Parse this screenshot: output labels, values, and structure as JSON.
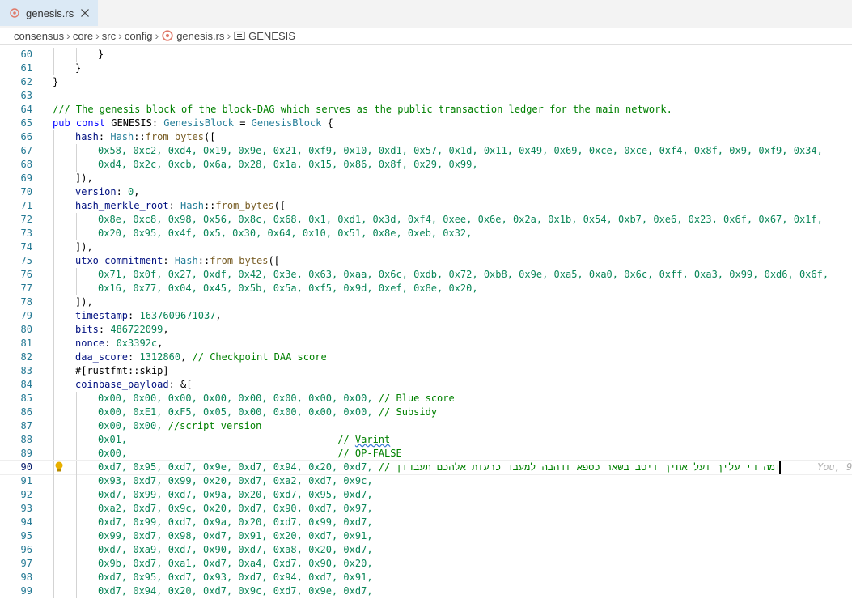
{
  "tab": {
    "filename": "genesis.rs"
  },
  "breadcrumb": [
    "consensus",
    "core",
    "src",
    "config",
    "genesis.rs",
    "GENESIS"
  ],
  "blame_text": "You, 9",
  "lines": [
    {
      "n": "60",
      "i": 2,
      "s": [
        [
          "}",
          ""
        ]
      ]
    },
    {
      "n": "61",
      "i": 1,
      "s": [
        [
          "}",
          ""
        ]
      ]
    },
    {
      "n": "62",
      "i": 0,
      "s": [
        [
          "}",
          ""
        ]
      ]
    },
    {
      "n": "63",
      "i": 0,
      "s": []
    },
    {
      "n": "64",
      "i": 0,
      "s": [
        [
          "/// The genesis block of the block-DAG which serves as the public transaction ledger for the main network.",
          "c"
        ]
      ]
    },
    {
      "n": "65",
      "i": 0,
      "s": [
        [
          "pub const ",
          "k"
        ],
        [
          "GENESIS",
          ""
        ],
        [
          ": ",
          ""
        ],
        [
          "GenesisBlock",
          "t"
        ],
        [
          " = ",
          ""
        ],
        [
          "GenesisBlock",
          "t"
        ],
        [
          " {",
          ""
        ]
      ]
    },
    {
      "n": "66",
      "i": 1,
      "s": [
        [
          "hash",
          "p"
        ],
        [
          ": ",
          ""
        ],
        [
          "Hash",
          "t"
        ],
        [
          "::",
          ""
        ],
        [
          "from_bytes",
          "f"
        ],
        [
          "([",
          ""
        ]
      ]
    },
    {
      "n": "67",
      "i": 2,
      "s": [
        [
          "0x58, 0xc2, 0xd4, 0x19, 0x9e, 0x21, 0xf9, 0x10, 0xd1, 0x57, 0x1d, 0x11, 0x49, 0x69, 0xce, 0xce, 0xf4, 0x8f, 0x9, 0xf9, 0x34,",
          "n"
        ]
      ]
    },
    {
      "n": "68",
      "i": 2,
      "s": [
        [
          "0xd4, 0x2c, 0xcb, 0x6a, 0x28, 0x1a, 0x15, 0x86, 0x8f, 0x29, 0x99,",
          "n"
        ]
      ]
    },
    {
      "n": "69",
      "i": 1,
      "s": [
        [
          "]),",
          ""
        ]
      ]
    },
    {
      "n": "70",
      "i": 1,
      "s": [
        [
          "version",
          "p"
        ],
        [
          ": ",
          ""
        ],
        [
          "0",
          "n"
        ],
        [
          ",",
          ""
        ]
      ]
    },
    {
      "n": "71",
      "i": 1,
      "s": [
        [
          "hash_merkle_root",
          "p"
        ],
        [
          ": ",
          ""
        ],
        [
          "Hash",
          "t"
        ],
        [
          "::",
          ""
        ],
        [
          "from_bytes",
          "f"
        ],
        [
          "([",
          ""
        ]
      ]
    },
    {
      "n": "72",
      "i": 2,
      "s": [
        [
          "0x8e, 0xc8, 0x98, 0x56, 0x8c, 0x68, 0x1, 0xd1, 0x3d, 0xf4, 0xee, 0x6e, 0x2a, 0x1b, 0x54, 0xb7, 0xe6, 0x23, 0x6f, 0x67, 0x1f,",
          "n"
        ]
      ]
    },
    {
      "n": "73",
      "i": 2,
      "s": [
        [
          "0x20, 0x95, 0x4f, 0x5, 0x30, 0x64, 0x10, 0x51, 0x8e, 0xeb, 0x32,",
          "n"
        ]
      ]
    },
    {
      "n": "74",
      "i": 1,
      "s": [
        [
          "]),",
          ""
        ]
      ]
    },
    {
      "n": "75",
      "i": 1,
      "s": [
        [
          "utxo_commitment",
          "p"
        ],
        [
          ": ",
          ""
        ],
        [
          "Hash",
          "t"
        ],
        [
          "::",
          ""
        ],
        [
          "from_bytes",
          "f"
        ],
        [
          "([",
          ""
        ]
      ]
    },
    {
      "n": "76",
      "i": 2,
      "s": [
        [
          "0x71, 0x0f, 0x27, 0xdf, 0x42, 0x3e, 0x63, 0xaa, 0x6c, 0xdb, 0x72, 0xb8, 0x9e, 0xa5, 0xa0, 0x6c, 0xff, 0xa3, 0x99, 0xd6, 0x6f,",
          "n"
        ]
      ]
    },
    {
      "n": "77",
      "i": 2,
      "s": [
        [
          "0x16, 0x77, 0x04, 0x45, 0x5b, 0x5a, 0xf5, 0x9d, 0xef, 0x8e, 0x20,",
          "n"
        ]
      ]
    },
    {
      "n": "78",
      "i": 1,
      "s": [
        [
          "]),",
          ""
        ]
      ]
    },
    {
      "n": "79",
      "i": 1,
      "s": [
        [
          "timestamp",
          "p"
        ],
        [
          ": ",
          ""
        ],
        [
          "1637609671037",
          "n"
        ],
        [
          ",",
          ""
        ]
      ]
    },
    {
      "n": "80",
      "i": 1,
      "s": [
        [
          "bits",
          "p"
        ],
        [
          ": ",
          ""
        ],
        [
          "486722099",
          "n"
        ],
        [
          ",",
          ""
        ]
      ]
    },
    {
      "n": "81",
      "i": 1,
      "s": [
        [
          "nonce",
          "p"
        ],
        [
          ": ",
          ""
        ],
        [
          "0x3392c",
          "n"
        ],
        [
          ",",
          ""
        ]
      ]
    },
    {
      "n": "82",
      "i": 1,
      "s": [
        [
          "daa_score",
          "p"
        ],
        [
          ": ",
          ""
        ],
        [
          "1312860",
          "n"
        ],
        [
          ", ",
          ""
        ],
        [
          "// Checkpoint DAA score",
          "c"
        ]
      ]
    },
    {
      "n": "83",
      "i": 1,
      "s": [
        [
          "#[rustfmt::skip]",
          ""
        ]
      ]
    },
    {
      "n": "84",
      "i": 1,
      "s": [
        [
          "coinbase_payload",
          "p"
        ],
        [
          ": &[",
          ""
        ]
      ]
    },
    {
      "n": "85",
      "i": 2,
      "s": [
        [
          "0x00, 0x00, 0x00, 0x00, 0x00, 0x00, 0x00, 0x00,",
          "n"
        ],
        [
          " ",
          ""
        ],
        [
          "// Blue score",
          "c"
        ]
      ]
    },
    {
      "n": "86",
      "i": 2,
      "s": [
        [
          "0x00, 0xE1, 0xF5, 0x05, 0x00, 0x00, 0x00, 0x00,",
          "n"
        ],
        [
          " ",
          ""
        ],
        [
          "// Subsidy",
          "c"
        ]
      ]
    },
    {
      "n": "87",
      "i": 2,
      "s": [
        [
          "0x00, 0x00,",
          "n"
        ],
        [
          " ",
          ""
        ],
        [
          "//script version",
          "c"
        ]
      ]
    },
    {
      "n": "88",
      "i": 2,
      "s": [
        [
          "0x01,",
          "n"
        ],
        [
          "                                    ",
          ""
        ],
        [
          "// ",
          "c"
        ],
        [
          "Varint",
          "csq"
        ]
      ]
    },
    {
      "n": "89",
      "i": 2,
      "s": [
        [
          "0x00,",
          "n"
        ],
        [
          "                                    ",
          ""
        ],
        [
          "// OP-FALSE",
          "c"
        ]
      ]
    },
    {
      "n": "90",
      "i": 2,
      "hl": true,
      "s": [
        [
          "0xd7, 0x95, 0xd7, 0x9e, 0xd7, 0x94, 0x20, 0xd7,",
          "n"
        ],
        [
          " ",
          ""
        ],
        [
          "// ומה די עליך ועל אחיך ויטב בשאר כספא ודהבה למעבד כרעות אלהכם תעבדון",
          "c"
        ]
      ]
    },
    {
      "n": "91",
      "i": 2,
      "s": [
        [
          "0x93, 0xd7, 0x99, 0x20, 0xd7, 0xa2, 0xd7, 0x9c,",
          "n"
        ]
      ]
    },
    {
      "n": "92",
      "i": 2,
      "s": [
        [
          "0xd7, 0x99, 0xd7, 0x9a, 0x20, 0xd7, 0x95, 0xd7,",
          "n"
        ]
      ]
    },
    {
      "n": "93",
      "i": 2,
      "s": [
        [
          "0xa2, 0xd7, 0x9c, 0x20, 0xd7, 0x90, 0xd7, 0x97,",
          "n"
        ]
      ]
    },
    {
      "n": "94",
      "i": 2,
      "s": [
        [
          "0xd7, 0x99, 0xd7, 0x9a, 0x20, 0xd7, 0x99, 0xd7,",
          "n"
        ]
      ]
    },
    {
      "n": "95",
      "i": 2,
      "s": [
        [
          "0x99, 0xd7, 0x98, 0xd7, 0x91, 0x20, 0xd7, 0x91,",
          "n"
        ]
      ]
    },
    {
      "n": "96",
      "i": 2,
      "s": [
        [
          "0xd7, 0xa9, 0xd7, 0x90, 0xd7, 0xa8, 0x20, 0xd7,",
          "n"
        ]
      ]
    },
    {
      "n": "97",
      "i": 2,
      "s": [
        [
          "0x9b, 0xd7, 0xa1, 0xd7, 0xa4, 0xd7, 0x90, 0x20,",
          "n"
        ]
      ]
    },
    {
      "n": "98",
      "i": 2,
      "s": [
        [
          "0xd7, 0x95, 0xd7, 0x93, 0xd7, 0x94, 0xd7, 0x91,",
          "n"
        ]
      ]
    },
    {
      "n": "99",
      "i": 2,
      "s": [
        [
          "0xd7, 0x94, 0x20, 0xd7, 0x9c, 0xd7, 0x9e, 0xd7,",
          "n"
        ]
      ]
    }
  ]
}
